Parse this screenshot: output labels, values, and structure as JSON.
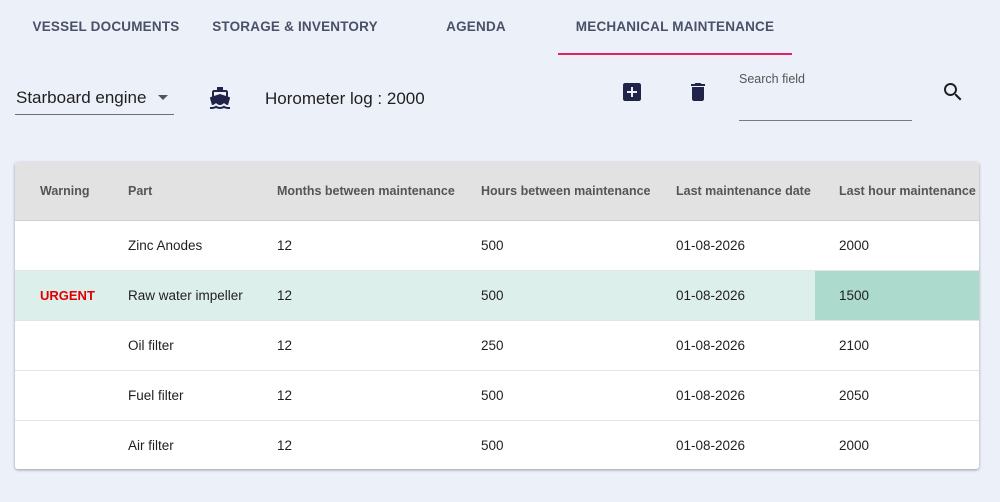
{
  "tabs": [
    {
      "label": "VESSEL DOCUMENTS",
      "active": false
    },
    {
      "label": "STORAGE & INVENTORY",
      "active": false
    },
    {
      "label": "AGENDA",
      "active": false
    },
    {
      "label": "MECHANICAL MAINTENANCE",
      "active": true
    }
  ],
  "toolbar": {
    "engine_select": {
      "value": "Starboard engine"
    },
    "horometer": "Horometer log : 2000",
    "search": {
      "label": "Search field",
      "value": "",
      "placeholder": ""
    },
    "icons": {
      "vessel": "boat-icon",
      "add": "add-box-icon",
      "delete": "trash-icon",
      "search": "search-icon"
    }
  },
  "table": {
    "columns": [
      "Warning",
      "Part",
      "Months between maintenance",
      "Hours between maintenance",
      "Last maintenance date",
      "Last hour maintenance"
    ],
    "rows": [
      {
        "warning": "",
        "part": "Zinc Anodes",
        "months": "12",
        "hours": "500",
        "last_date": "01-08-2026",
        "last_hour": "2000",
        "highlight": false
      },
      {
        "warning": "URGENT",
        "part": "Raw water impeller",
        "months": "12",
        "hours": "500",
        "last_date": "01-08-2026",
        "last_hour": "1500",
        "highlight": true
      },
      {
        "warning": "",
        "part": "Oil filter",
        "months": "12",
        "hours": "250",
        "last_date": "01-08-2026",
        "last_hour": "2100",
        "highlight": false
      },
      {
        "warning": "",
        "part": "Fuel filter",
        "months": "12",
        "hours": "500",
        "last_date": "01-08-2026",
        "last_hour": "2050",
        "highlight": false
      },
      {
        "warning": "",
        "part": "Air filter",
        "months": "12",
        "hours": "500",
        "last_date": "01-08-2026",
        "last_hour": "2000",
        "highlight": false
      }
    ]
  },
  "colors": {
    "background": "#ecf0f8",
    "tab_text": "#4a5166",
    "tab_indicator": "#e0245e",
    "icon": "#1f2448",
    "urgent": "#e00000",
    "row_highlight": "#dcefeb",
    "cell_alert": "#acdacd",
    "header_bg": "#e2e2e2"
  }
}
